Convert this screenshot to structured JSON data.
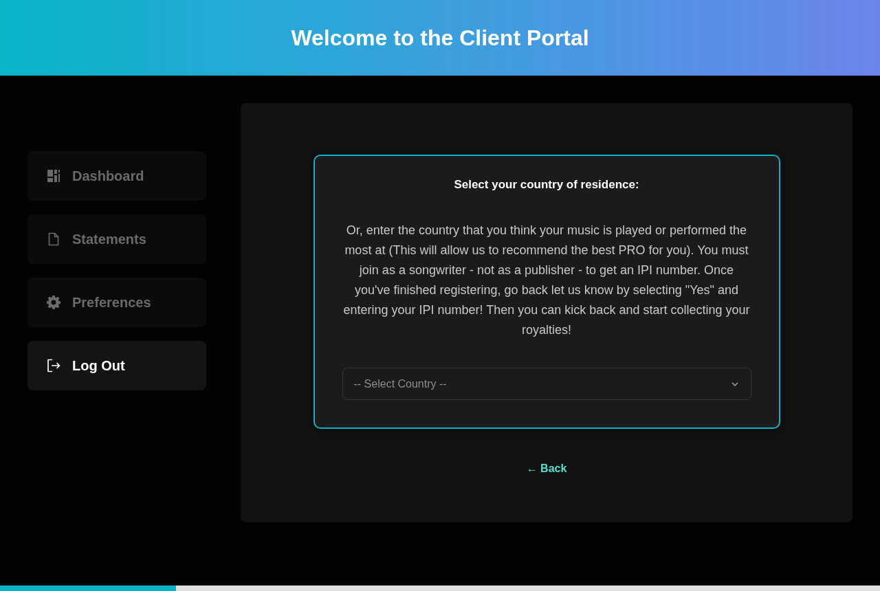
{
  "header": {
    "title": "Welcome to the Client Portal"
  },
  "sidebar": {
    "items": [
      {
        "label": "Dashboard",
        "kind": "dashboard",
        "disabled": true
      },
      {
        "label": "Statements",
        "kind": "document",
        "disabled": true
      },
      {
        "label": "Preferences",
        "kind": "settings",
        "disabled": true
      },
      {
        "label": "Log Out",
        "kind": "logout",
        "disabled": false
      }
    ]
  },
  "card": {
    "heading": "Select your country of residence:",
    "description": "Or, enter the country that you think your music is played or performed the most at (This will allow us to recommend the best PRO for you). You must join as a songwriter - not as a publisher - to get an IPI number. Once you've finished registering, go back let us know by selecting \"Yes\" and entering your IPI number! Then you can kick back and start collecting your royalties!",
    "country_select": {
      "placeholder": "-- Select Country --"
    }
  },
  "back_link": "← Back",
  "progress": {
    "level": 0.2
  }
}
